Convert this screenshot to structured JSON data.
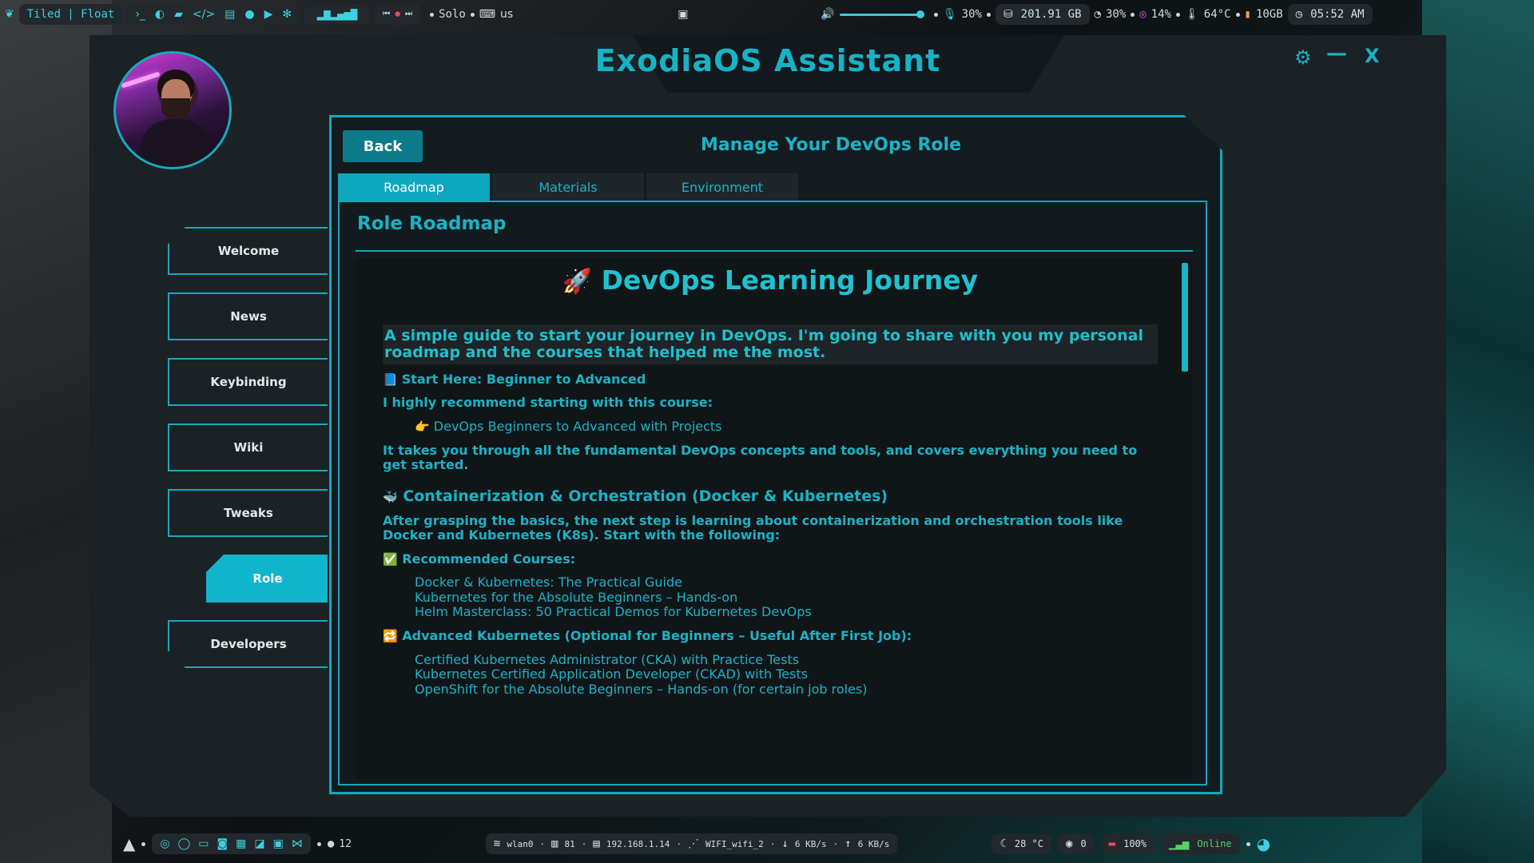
{
  "topbar": {
    "layout_label": "Tiled | Float",
    "mode_label": "Solo",
    "keyboard_layout": "us",
    "volume_level": 1.0,
    "mic_label": "30%",
    "disk_label": "201.91 GB",
    "cpu_label": "30%",
    "gpu_label": "14%",
    "temp_label": "64°C",
    "ram_label": "10GB",
    "clock_label": "05:52 AM",
    "launcher_icons": [
      "terminal-icon",
      "browser-icon",
      "folder-icon",
      "code-icon",
      "editor-icon",
      "chat-icon",
      "youtube-icon",
      "settings-icon"
    ]
  },
  "window": {
    "title": "ExodiaOS Assistant",
    "settings_icon": "⚙",
    "minimize_icon": "—",
    "close_icon": "X"
  },
  "sidebar": {
    "items": [
      {
        "label": "Welcome"
      },
      {
        "label": "News"
      },
      {
        "label": "Keybinding"
      },
      {
        "label": "Wiki"
      },
      {
        "label": "Tweaks"
      },
      {
        "label": "Role"
      },
      {
        "label": "Developers"
      }
    ],
    "active": "Role"
  },
  "panel": {
    "back_label": "Back",
    "title": "Manage Your DevOps Role",
    "tabs": [
      "Roadmap",
      "Materials",
      "Environment"
    ],
    "active_tab": "Roadmap",
    "section_title": "Role Roadmap"
  },
  "doc": {
    "title_emoji": "🚀",
    "title": "DevOps Learning Journey",
    "intro": "A simple guide to start your journey in DevOps. I'm going to share with you my personal roadmap and the courses that helped me the most.",
    "start_emoji": "📘",
    "start_heading": "Start Here: Beginner to Advanced",
    "recommend_text": "I highly recommend starting with this course:",
    "course_emoji": "👉",
    "course_link": "DevOps Beginners to Advanced with Projects",
    "course_desc": "It takes you through all the fundamental DevOps concepts and tools, and covers everything you need to get started.",
    "container_emoji": "🐳",
    "container_heading": "Containerization & Orchestration (Docker & Kubernetes)",
    "container_text": "After grasping the basics, the next step is learning about containerization and orchestration tools like Docker and Kubernetes (K8s). Start with the following:",
    "rec_emoji": "✅",
    "rec_heading": "Recommended Courses:",
    "rec_courses": [
      "Docker & Kubernetes: The Practical Guide",
      "Kubernetes for the Absolute Beginners – Hands-on",
      "Helm Masterclass: 50 Practical Demos for Kubernetes DevOps"
    ],
    "adv_emoji": "🔁",
    "adv_heading": "Advanced Kubernetes (Optional for Beginners – Useful After First Job):",
    "adv_courses": [
      "Certified Kubernetes Administrator (CKA) with Practice Tests",
      "Kubernetes Certified Application Developer (CKAD) with Tests",
      "OpenShift for the Absolute Beginners – Hands-on (for certain job roles)"
    ]
  },
  "bottombar": {
    "workspace_count": "12",
    "network_label": "wlan0",
    "signal_label": "81",
    "ip_label": "192.168.1.14",
    "ssid_label": "WIFI_wifi_2",
    "download_label": "6 KB/s",
    "upload_label": "6 KB/s",
    "weather_label": "28 °C",
    "github_label": "0",
    "battery_label": "100%",
    "status_label": "Online",
    "dock_icons": [
      "chrome-icon",
      "whatsapp-icon",
      "laptop-icon",
      "discord-icon",
      "files-icon",
      "studio-icon",
      "terminal-icon",
      "vscode-icon"
    ]
  },
  "colors": {
    "accent": "#1ab3c6",
    "accent_fill": "#10a8bf",
    "background": "#1b2226"
  }
}
